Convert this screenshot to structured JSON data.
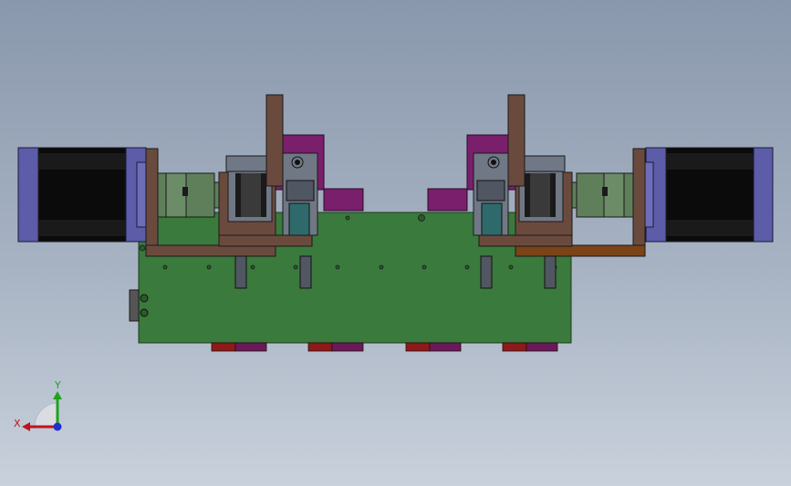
{
  "colors": {
    "background_top": "#8a98ad",
    "background_bottom": "#c9d1dc",
    "board_green": "#3a7a3c",
    "motor_black": "#0b0b0b",
    "motor_endcap": "#5c5ca8",
    "bracket_brown": "#6b4a3e",
    "bracket_orange": "#7b4318",
    "coupling_green": "#5f7f5a",
    "carriage_grey": "#707885",
    "slider_teal": "#2e6a6c",
    "purple_block": "#7a1f6c",
    "red_block": "#8e1a1a",
    "axis_x": "#c0141b",
    "axis_y": "#1ea31e",
    "axis_origin": "#1f2fd0"
  },
  "triad": {
    "x_label": "X",
    "y_label": "Y"
  }
}
